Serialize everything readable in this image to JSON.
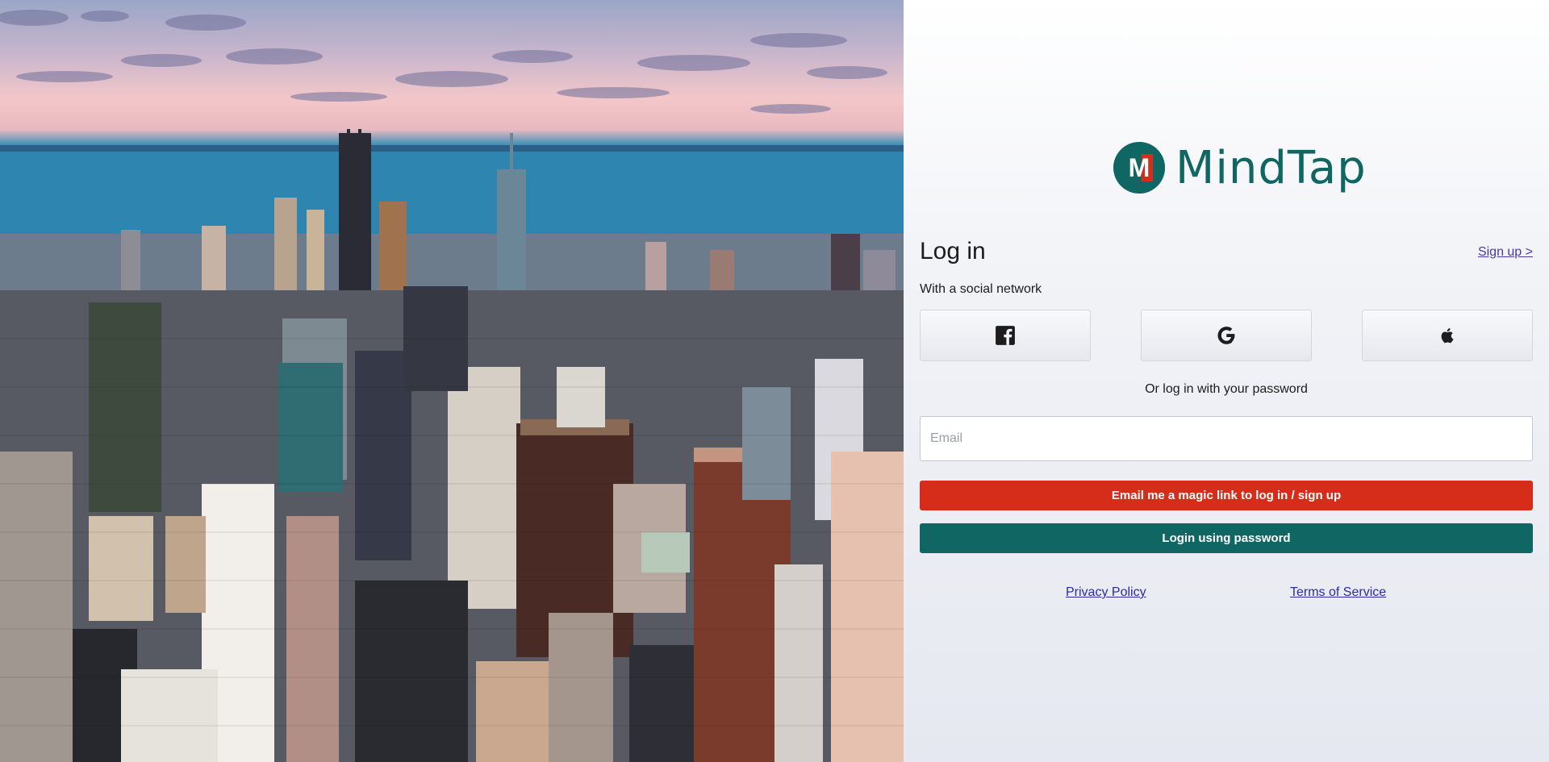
{
  "hero": {
    "image_icon": "city-skyline-photo"
  },
  "brand": {
    "name": "MindTap",
    "logo_letter": "M",
    "color": "#0f6663",
    "accent": "#d52d19"
  },
  "login": {
    "title": "Log in",
    "signup_link": "Sign up >",
    "social_label": "With a social network",
    "social_buttons": [
      {
        "icon": "facebook-icon"
      },
      {
        "icon": "google-icon"
      },
      {
        "icon": "apple-icon"
      }
    ],
    "or_label": "Or log in with your password",
    "email_placeholder": "Email",
    "email_value": "",
    "magic_link_button": "Email me a magic link to log in / sign up",
    "password_button": "Login using password"
  },
  "footer": {
    "privacy_label": "Privacy Policy",
    "terms_label": "Terms of Service"
  }
}
